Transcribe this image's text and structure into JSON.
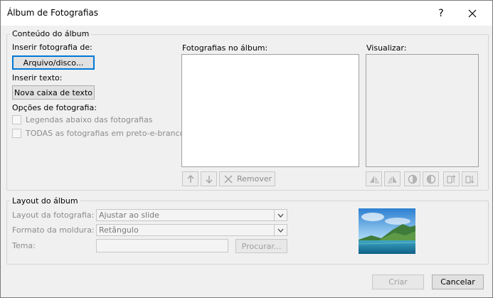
{
  "dialog": {
    "title": "Álbum de Fotografias",
    "help_glyph": "?",
    "close_glyph": "✕"
  },
  "album_content": {
    "group_label": "Conteúdo do álbum",
    "insert_photo_label": "Inserir fotografia de:",
    "file_disk_button": "Arquivo/disco...",
    "insert_text_label": "Inserir texto:",
    "new_textbox_button": "Nova caixa de texto",
    "photo_options_label": "Opções de fotografia:",
    "captions_option": "Legendas abaixo das fotografias",
    "captions_checked": false,
    "bw_option": "TODAS as fotografias em preto-e-branco",
    "bw_checked": false,
    "photos_in_album_label": "Fotografias no álbum:",
    "remove_button": "Remover",
    "preview_label": "Visualizar:"
  },
  "album_layout": {
    "group_label": "Layout do álbum",
    "photo_layout_label": "Layout da fotografia:",
    "photo_layout_value": "Ajustar ao slide",
    "frame_shape_label": "Formato da moldura:",
    "frame_shape_value": "Retângulo",
    "theme_label": "Tema:",
    "theme_value": "",
    "browse_button": "Procurar..."
  },
  "footer": {
    "create_button": "Criar",
    "cancel_button": "Cancelar"
  }
}
